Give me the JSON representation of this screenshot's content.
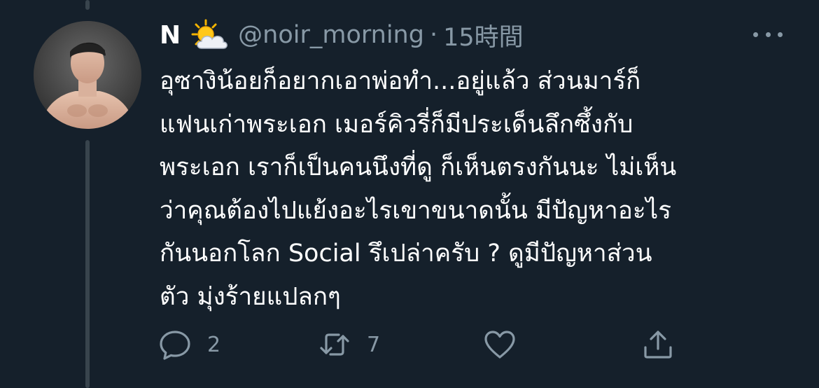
{
  "tweet": {
    "display_name": "N",
    "name_emoji_icon": "sun-behind-cloud-icon",
    "handle": "@noir_morning",
    "separator": "·",
    "time": "15時間",
    "text_lines": [
      "อุซางิน้อยก็อยากเอาพ่อทำ...อยู่แล้ว ส่วนมาร์ก็",
      "แฟนเก่าพระเอก เมอร์คิวรี่ก็มีประเด็นลึกซึ้งกับ",
      "พระเอก เราก็เป็นคนนึงที่ดู ก็เห็นตรงกันนะ  ไม่เห็น",
      "ว่าคุณต้องไปแย้งอะไรเขาขนาดนั้น มีปัญหาอะไร",
      "กันนอกโลก Social รึเปล่าครับ ? ดูมีปัญหาส่วน",
      "ตัว มุ่งร้ายแปลกๆ"
    ],
    "actions": {
      "reply": {
        "icon": "reply-icon",
        "count": "2"
      },
      "retweet": {
        "icon": "retweet-icon",
        "count": "7"
      },
      "like": {
        "icon": "heart-icon",
        "count": ""
      },
      "share": {
        "icon": "share-icon",
        "count": ""
      }
    }
  },
  "colors": {
    "background": "#15202b",
    "primary_text": "#ffffff",
    "secondary_text": "#8899a6",
    "thread_line": "#38444d"
  }
}
